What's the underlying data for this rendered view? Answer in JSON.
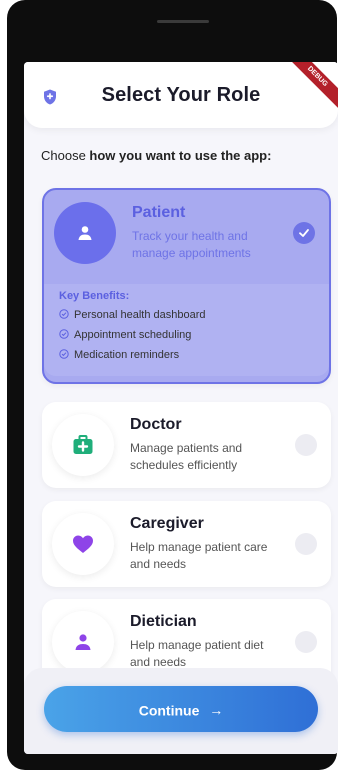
{
  "header": {
    "title": "Select Your Role",
    "debug_label": "DEBUG"
  },
  "subtitle": {
    "prefix": "Choose ",
    "bold": "how you want to use the app:"
  },
  "roles": [
    {
      "title": "Patient",
      "description": "Track your health and manage appointments",
      "icon": "user-icon",
      "selected": true,
      "benefits_title": "Key Benefits:",
      "benefits": [
        "Personal health dashboard",
        "Appointment scheduling",
        "Medication reminders"
      ]
    },
    {
      "title": "Doctor",
      "description": "Manage patients and schedules efficiently",
      "icon": "medical-kit-icon",
      "selected": false
    },
    {
      "title": "Caregiver",
      "description": "Help manage patient care and needs",
      "icon": "heart-icon",
      "selected": false
    },
    {
      "title": "Dietician",
      "description": "Help manage patient diet and needs",
      "icon": "user-icon",
      "selected": false
    }
  ],
  "continue": {
    "label": "Continue",
    "arrow": "→"
  },
  "colors": {
    "accent": "#6e73e6",
    "doctor": "#1fae7a",
    "caregiver": "#8e44e8",
    "button_start": "#4aa3e8",
    "button_end": "#2f6fd6"
  }
}
